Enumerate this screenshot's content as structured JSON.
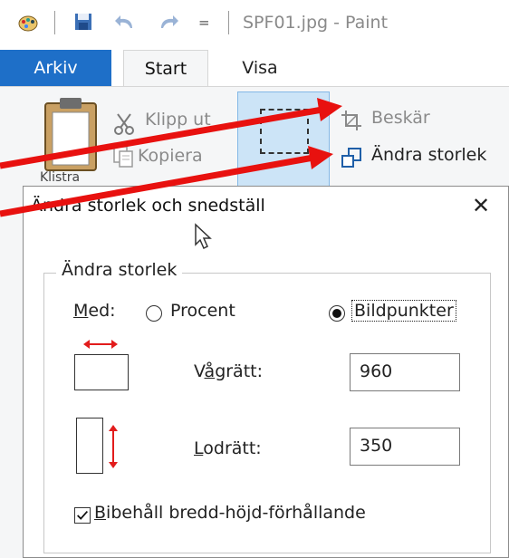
{
  "titlebar": {
    "title": "SPF01.jpg - Paint",
    "quick_access_dropdown": "="
  },
  "tabs": [
    {
      "label": "Arkiv",
      "active": false
    },
    {
      "label": "Start",
      "active": true
    },
    {
      "label": "Visa",
      "active": false
    }
  ],
  "ribbon": {
    "paste_label": "Klistra",
    "cut_label": "Klipp ut",
    "copy_label": "Kopiera",
    "crop_label": "Beskär",
    "resize_label": "Ändra storlek"
  },
  "dialog": {
    "title": "Ändra storlek och snedställ",
    "close_symbol": "✕",
    "group_label": "Ändra storlek",
    "by_label_prefix": "M",
    "by_label_rest": "ed:",
    "percent_label": "Procent",
    "pixels_label": "Bildpunkter",
    "horizontal_prefix": "V",
    "horizontal_underlined": "å",
    "horizontal_rest": "grätt:",
    "horizontal_value": "960",
    "vertical_prefix": "L",
    "vertical_rest": "odrätt:",
    "vertical_value": "350",
    "keep_ratio_prefix": "B",
    "keep_ratio_rest": "ibehåll bredd-höjd-förhållande",
    "keep_ratio_checked": true,
    "selected_unit": "Bildpunkter"
  },
  "colors": {
    "arkiv_tab": "#1e6fc8",
    "annotation_arrow": "#e8110f",
    "icon_red": "#e21c1c"
  }
}
